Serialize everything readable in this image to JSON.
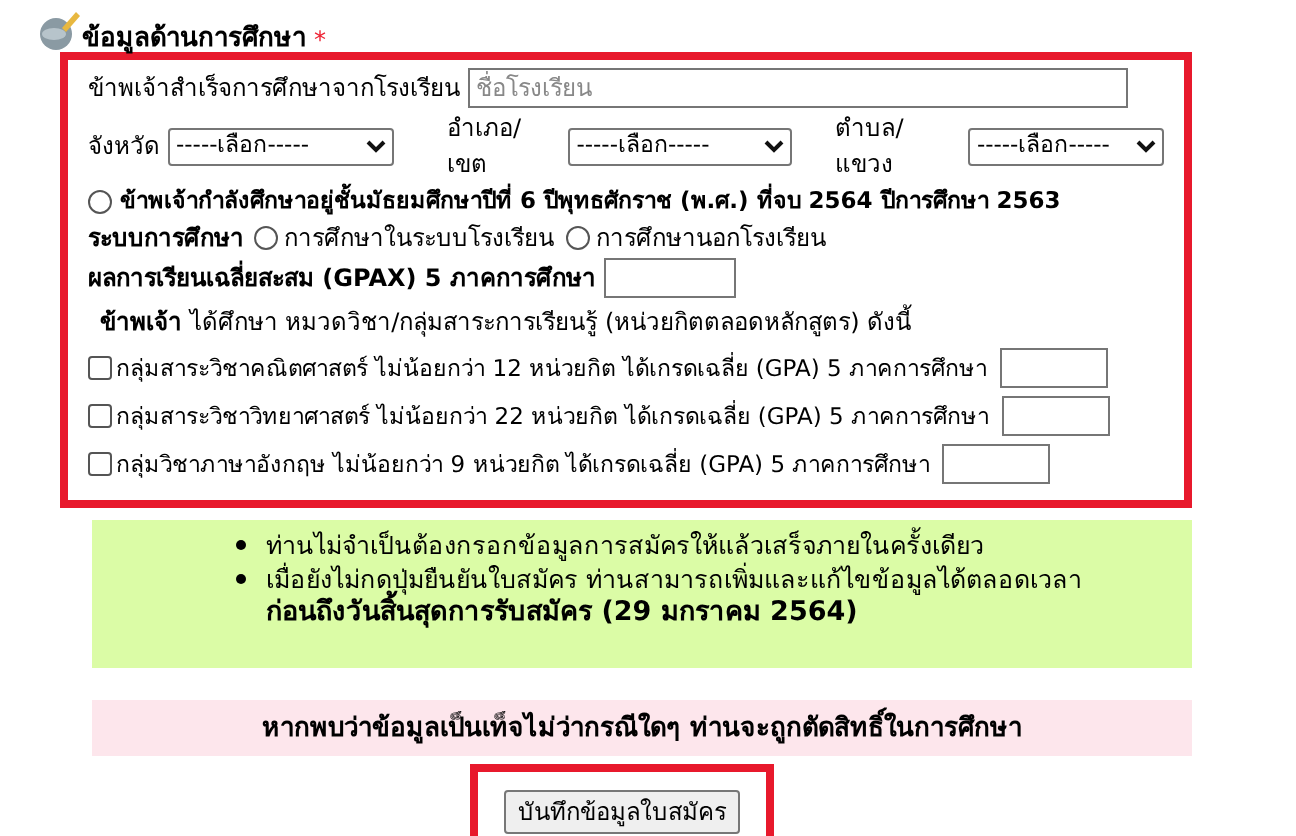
{
  "section": {
    "title": "ข้อมูลด้านการศึกษา",
    "required_mark": "*"
  },
  "school": {
    "label": "ข้าพเจ้าสำเร็จการศึกษาจากโรงเรียน",
    "placeholder": "ชื่อโรงเรียน"
  },
  "selects": [
    {
      "label": "จังหวัด",
      "value": "-----เลือก-----"
    },
    {
      "label": "อำเภอ/เขต",
      "value": "-----เลือก-----"
    },
    {
      "label": "ตำบล/แขวง",
      "value": "-----เลือก-----"
    }
  ],
  "status_option": {
    "label": "ข้าพเจ้ากำลังศึกษาอยู่ชั้นมัธยมศึกษาปีที่ 6 ปีพุทธศักราช (พ.ศ.) ที่จบ 2564 ปีการศึกษา 2563",
    "selected": false
  },
  "system": {
    "label": "ระบบการศึกษา",
    "options": [
      {
        "label": "การศึกษาในระบบโรงเรียน",
        "selected": false
      },
      {
        "label": "การศึกษานอกโรงเรียน",
        "selected": false
      }
    ]
  },
  "gpax": {
    "label": "ผลการเรียนเฉลี่ยสะสม (GPAX) 5 ภาคการศึกษา"
  },
  "subjects_intro": "**ข้าพเจ้า** ได้ศึกษา หมวดวิชา/กลุ่มสาระการเรียนรู้ (หน่วยกิตตลอดหลักสูตร) ดังนี้",
  "subjects": [
    {
      "label": "กลุ่มสาระวิชาคณิตศาสตร์ ไม่น้อยกว่า 12 หน่วยกิต ได้เกรดเฉลี่ย (GPA) 5 ภาคการศึกษา",
      "checked": false
    },
    {
      "label": "กลุ่มสาระวิชาวิทยาศาสตร์ ไม่น้อยกว่า 22 หน่วยกิต ได้เกรดเฉลี่ย (GPA) 5 ภาคการศึกษา",
      "checked": false
    },
    {
      "label": "กลุ่มวิชาภาษาอังกฤษ ไม่น้อยกว่า 9 หน่วยกิต ได้เกรดเฉลี่ย (GPA) 5 ภาคการศึกษา",
      "checked": false
    }
  ],
  "notes": [
    "ท่านไม่จำเป็นต้องกรอกข้อมูลการสมัครให้แล้วเสร็จภายในครั้งเดียว",
    "เมื่อยังไม่กดปุ่มยืนยันใบสมัคร ท่านสามารถเพิ่มและแก้ไขข้อมูลได้ตลอดเวลา"
  ],
  "deadline": "ก่อนถึงวันสิ้นสุดการรับสมัคร (29 มกราคม 2564)",
  "warning": "หากพบว่าข้อมูลเป็นเท็จไม่ว่ากรณีใดๆ ท่านจะถูกตัดสิทธิ์ในการศึกษา",
  "save_button": "บันทึกข้อมูลใบสมัคร"
}
